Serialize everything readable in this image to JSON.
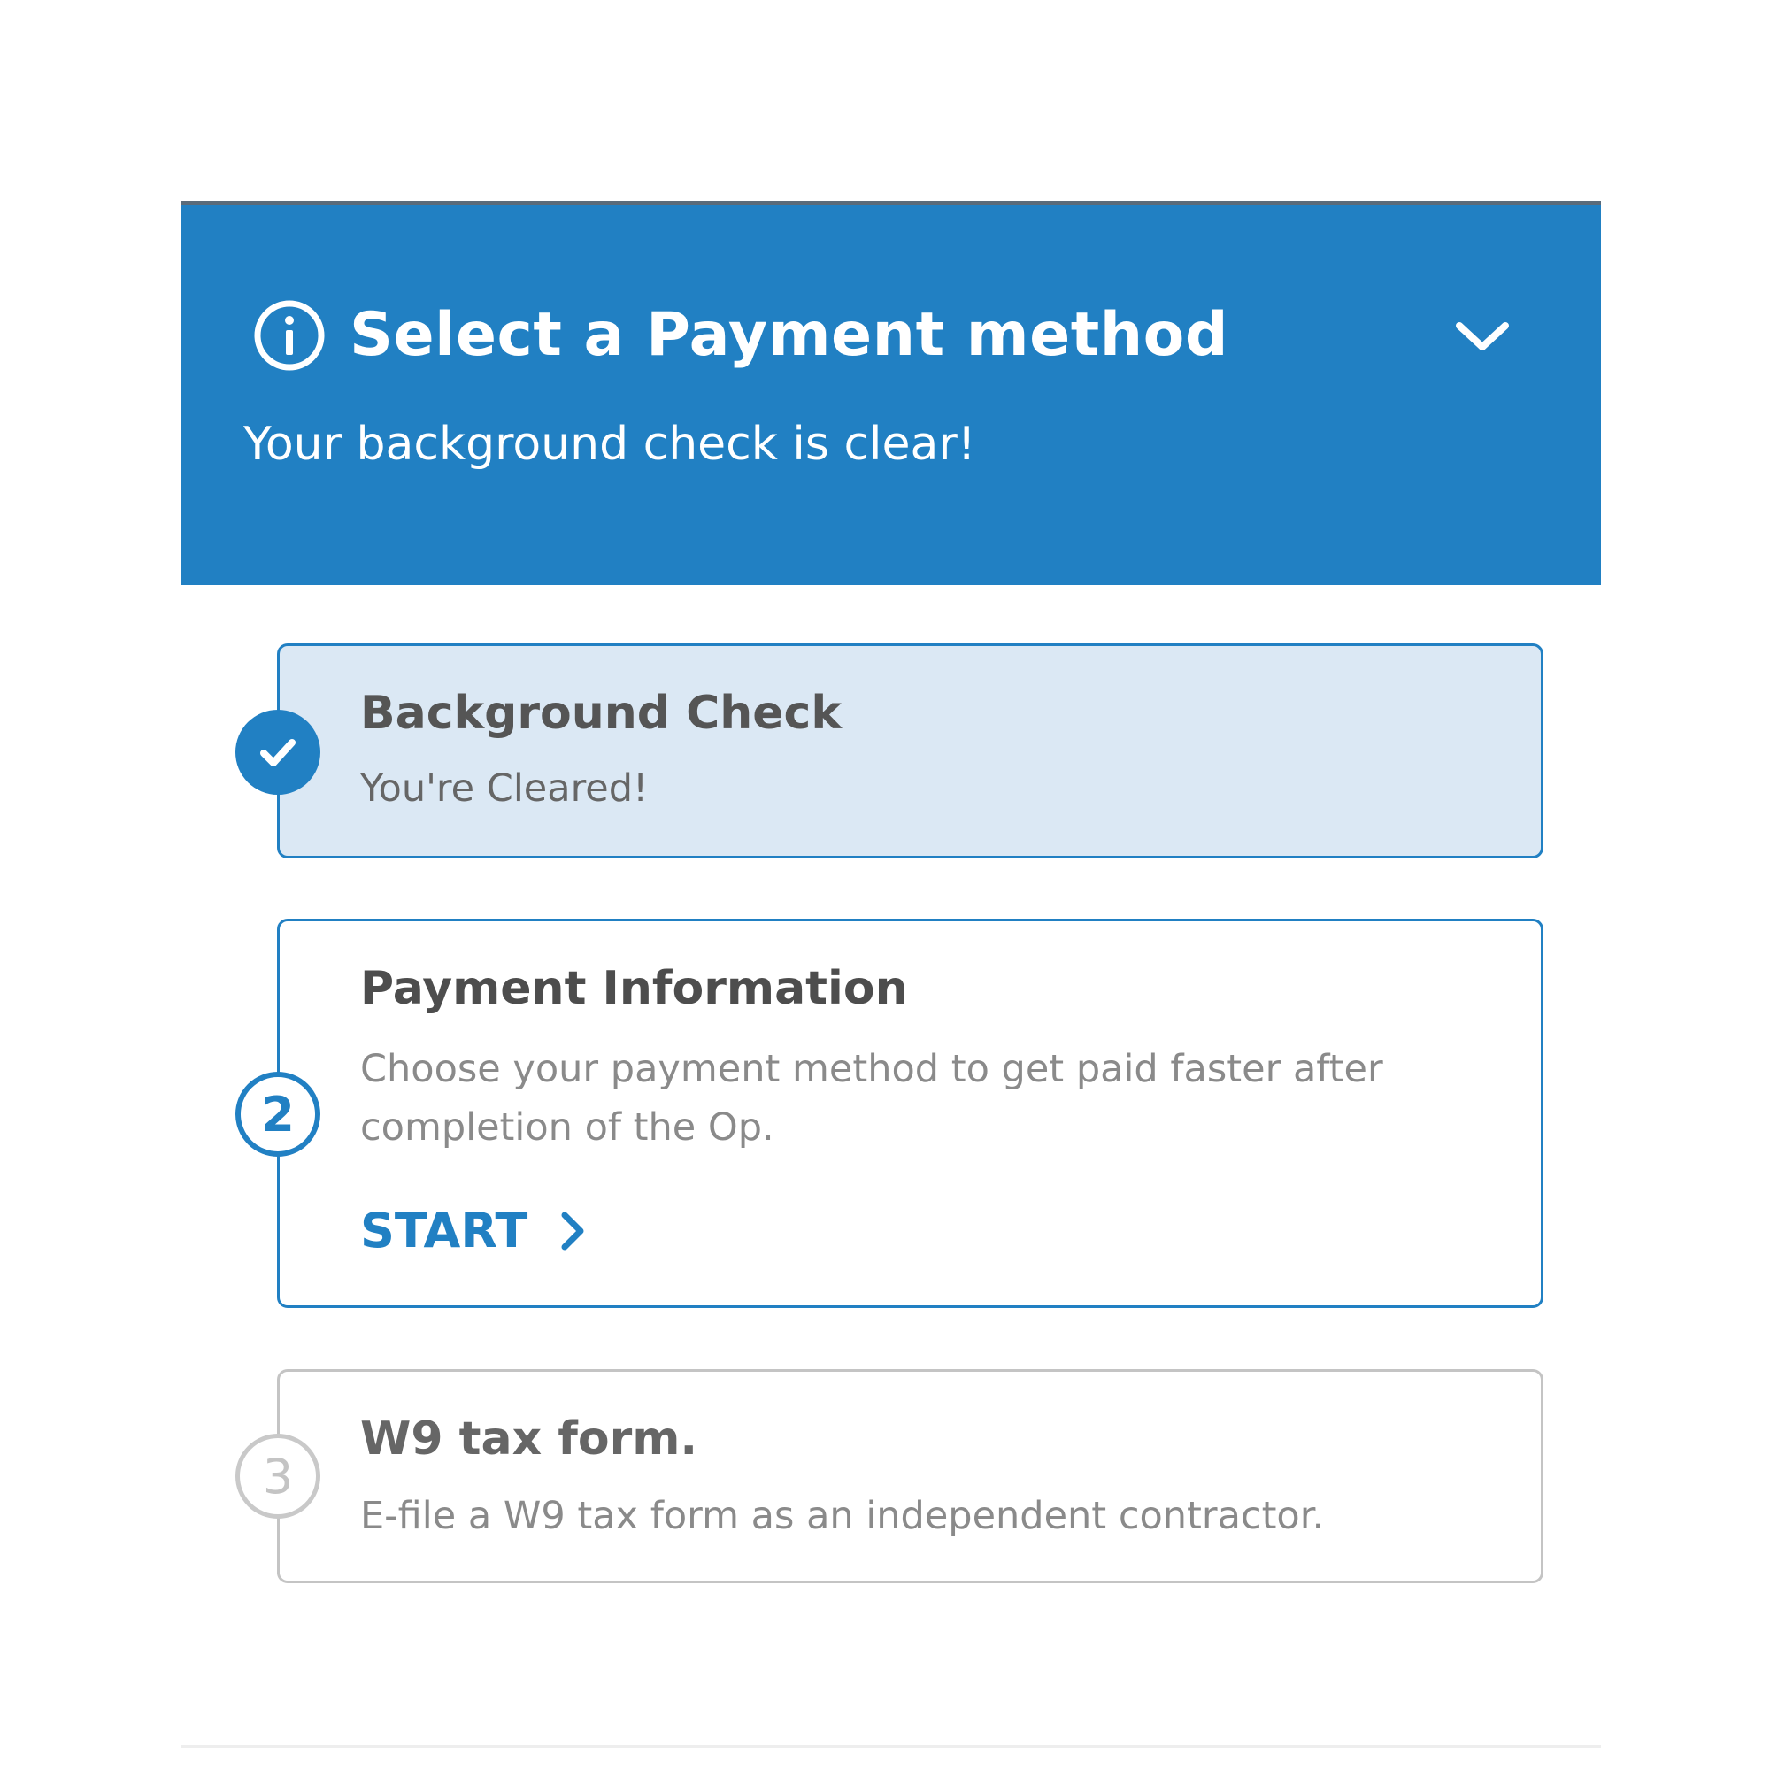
{
  "banner": {
    "title": "Select a Payment method",
    "subtitle": "Your background check is clear!",
    "icon": "info-icon",
    "toggle_icon": "chevron-down-icon",
    "background_color": "#2180c3"
  },
  "steps": [
    {
      "number": "1",
      "status": "completed",
      "marker_icon": "checkmark-icon",
      "title": "Background Check",
      "description": "You're Cleared!"
    },
    {
      "number": "2",
      "status": "current",
      "title": "Payment Information",
      "description": "Choose your payment method to get paid faster after completion of the Op.",
      "action_label": "START",
      "action_icon": "chevron-right-icon"
    },
    {
      "number": "3",
      "status": "pending",
      "title": "W9 tax form.",
      "description": "E-file a W9 tax form as an independent contractor."
    }
  ],
  "colors": {
    "accent": "#2180c3",
    "completed_card": "#dbe8f4",
    "pending_border": "#c4c4c4"
  }
}
